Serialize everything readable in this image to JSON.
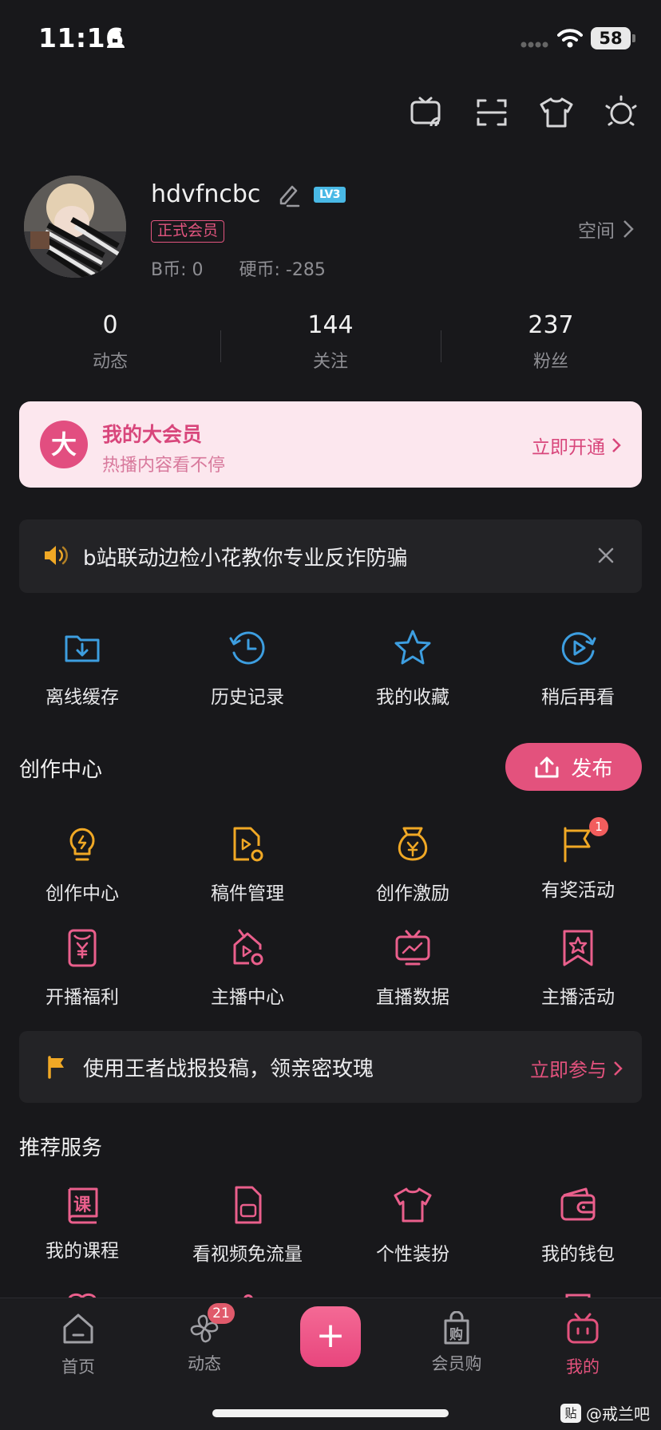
{
  "status_bar": {
    "time": "11:16",
    "battery": "58"
  },
  "profile": {
    "username": "hdvfncbc",
    "level_badge": "LV3",
    "vip_tag": "正式会员",
    "b_coin": "B币: 0",
    "coins": "硬币: -285",
    "space_link": "空间"
  },
  "stats": [
    {
      "value": "0",
      "label": "动态"
    },
    {
      "value": "144",
      "label": "关注"
    },
    {
      "value": "237",
      "label": "粉丝"
    }
  ],
  "vip_card": {
    "logo": "大",
    "title": "我的大会员",
    "subtitle": "热播内容看不停",
    "cta": "立即开通"
  },
  "notice": {
    "text": "b站联动边检小花教你专业反诈防骗"
  },
  "quick_links": [
    {
      "label": "离线缓存",
      "icon": "download-folder-icon"
    },
    {
      "label": "历史记录",
      "icon": "history-clock-icon"
    },
    {
      "label": "我的收藏",
      "icon": "star-icon"
    },
    {
      "label": "稍后再看",
      "icon": "watch-later-icon"
    }
  ],
  "creator": {
    "title": "创作中心",
    "publish_label": "发布",
    "items": [
      {
        "label": "创作中心",
        "icon": "lightbulb-icon"
      },
      {
        "label": "稿件管理",
        "icon": "manuscript-icon"
      },
      {
        "label": "创作激励",
        "icon": "money-bag-icon"
      },
      {
        "label": "有奖活动",
        "icon": "flag-icon",
        "badge": "1"
      },
      {
        "label": "开播福利",
        "icon": "coupon-yen-icon"
      },
      {
        "label": "主播中心",
        "icon": "streamer-home-icon"
      },
      {
        "label": "直播数据",
        "icon": "live-data-tv-icon"
      },
      {
        "label": "主播活动",
        "icon": "bookmark-star-icon"
      }
    ]
  },
  "promo": {
    "text": "使用王者战报投稿，领亲密玫瑰",
    "cta": "立即参与"
  },
  "services": {
    "title": "推荐服务",
    "items": [
      {
        "label": "我的课程",
        "icon": "course-book-icon",
        "glyph": "课"
      },
      {
        "label": "看视频免流量",
        "icon": "sim-card-icon"
      },
      {
        "label": "个性装扮",
        "icon": "tshirt-icon"
      },
      {
        "label": "我的钱包",
        "icon": "wallet-icon"
      }
    ]
  },
  "tabbar": [
    {
      "label": "首页",
      "icon": "home-icon"
    },
    {
      "label": "动态",
      "icon": "pinwheel-icon",
      "badge": "21"
    },
    {
      "label": "",
      "icon": "plus-icon",
      "glyph": "+"
    },
    {
      "label": "会员购",
      "icon": "shopping-bag-icon",
      "glyph": "购"
    },
    {
      "label": "我的",
      "icon": "tv-mine-icon"
    }
  ],
  "watermark": {
    "box": "贴",
    "text": "@戒兰吧"
  },
  "colors": {
    "accent": "#e3527d",
    "link_blue": "#3d9ee0",
    "gold": "#f0a825",
    "background": "#18181b"
  }
}
